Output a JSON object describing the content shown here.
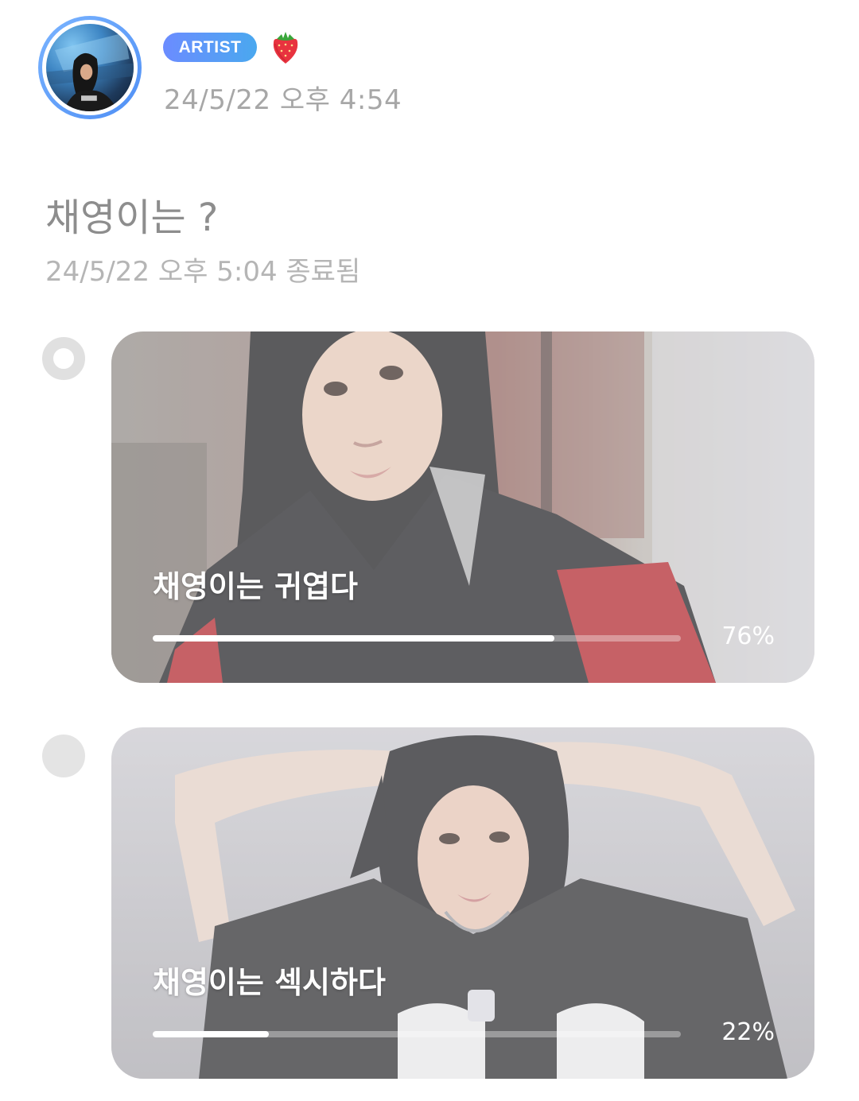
{
  "header": {
    "badge_label": "ARTIST",
    "emoji_icon": "strawberry-icon",
    "post_time": "24/5/22 오후 4:54",
    "badge_gradient": [
      "#6b8cff",
      "#4aa8ef"
    ],
    "avatar_ring_color": "#5b97f5"
  },
  "poll": {
    "title": "채영이는 ?",
    "ended_text": "24/5/22 오후 5:04 종료됨",
    "options": [
      {
        "label": "채영이는 귀엽다",
        "percent_text": "76%",
        "percent": 76,
        "selected": true
      },
      {
        "label": "채영이는 섹시하다",
        "percent_text": "22%",
        "percent": 22,
        "selected": false
      }
    ]
  }
}
